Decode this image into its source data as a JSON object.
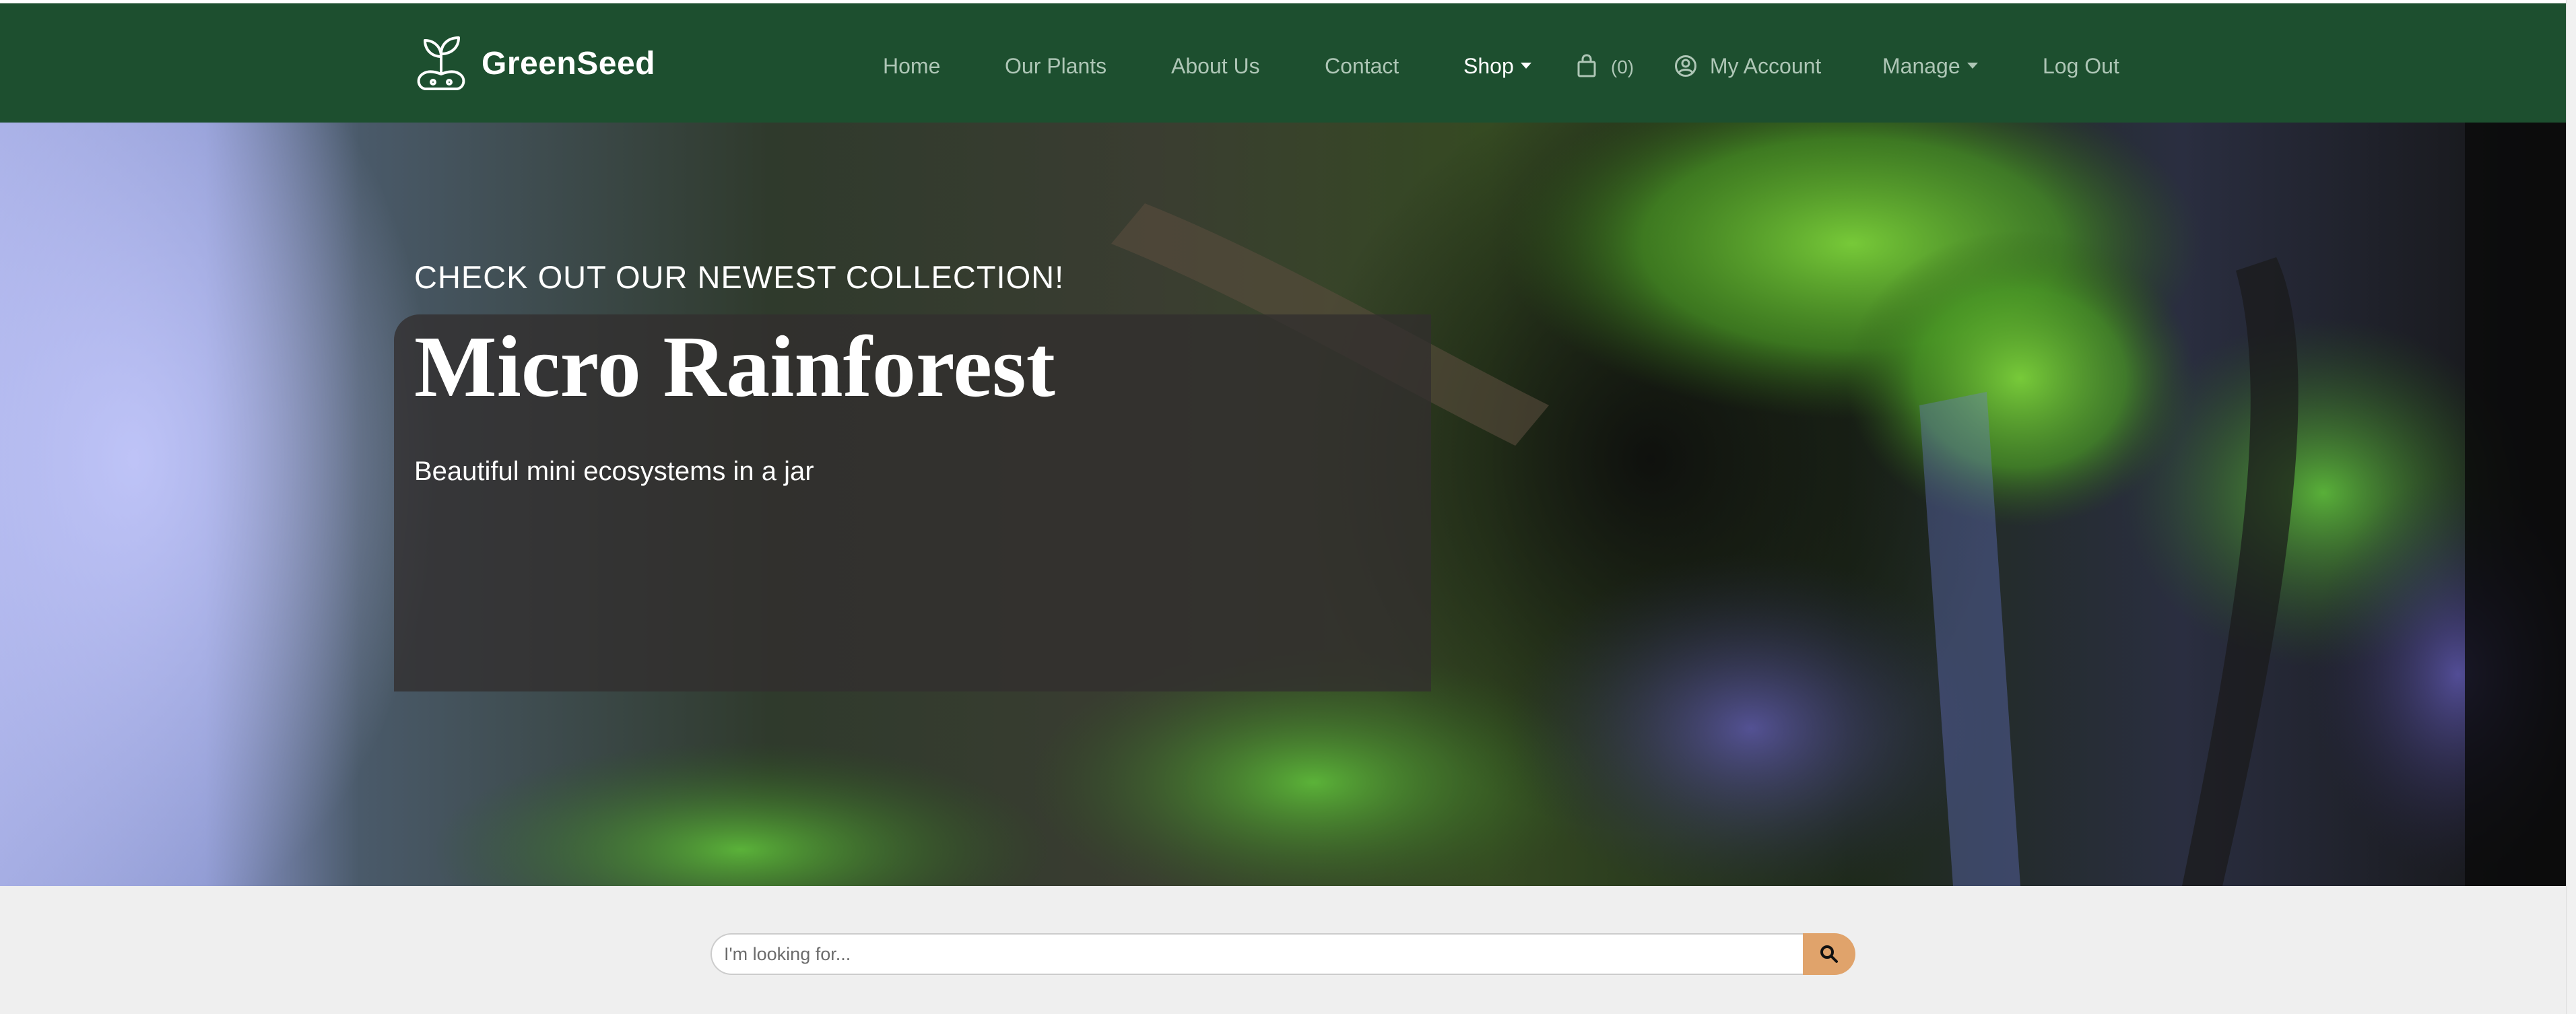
{
  "brand": {
    "name": "GreenSeed",
    "logo_icon": "seedling-logo-icon"
  },
  "nav": {
    "home": "Home",
    "plants": "Our Plants",
    "about": "About Us",
    "contact": "Contact",
    "shop": "Shop",
    "cart_count": "(0)",
    "account": "My Account",
    "manage": "Manage",
    "logout": "Log Out"
  },
  "hero": {
    "eyebrow": "CHECK OUT OUR NEWEST COLLECTION!",
    "title": "Micro Rainforest",
    "subtitle": "Beautiful mini ecosystems in a jar"
  },
  "search": {
    "placeholder": "I'm looking for...",
    "value": ""
  },
  "colors": {
    "navbar": "#1d4f2f",
    "nav_link": "#aec6b6",
    "nav_active": "#ffffff",
    "search_button": "#e0a36b",
    "page_background": "#efefef"
  },
  "icons": {
    "cart": "shopping-bag-icon",
    "account": "user-circle-icon",
    "search": "search-icon",
    "dropdown": "caret-down-icon"
  }
}
